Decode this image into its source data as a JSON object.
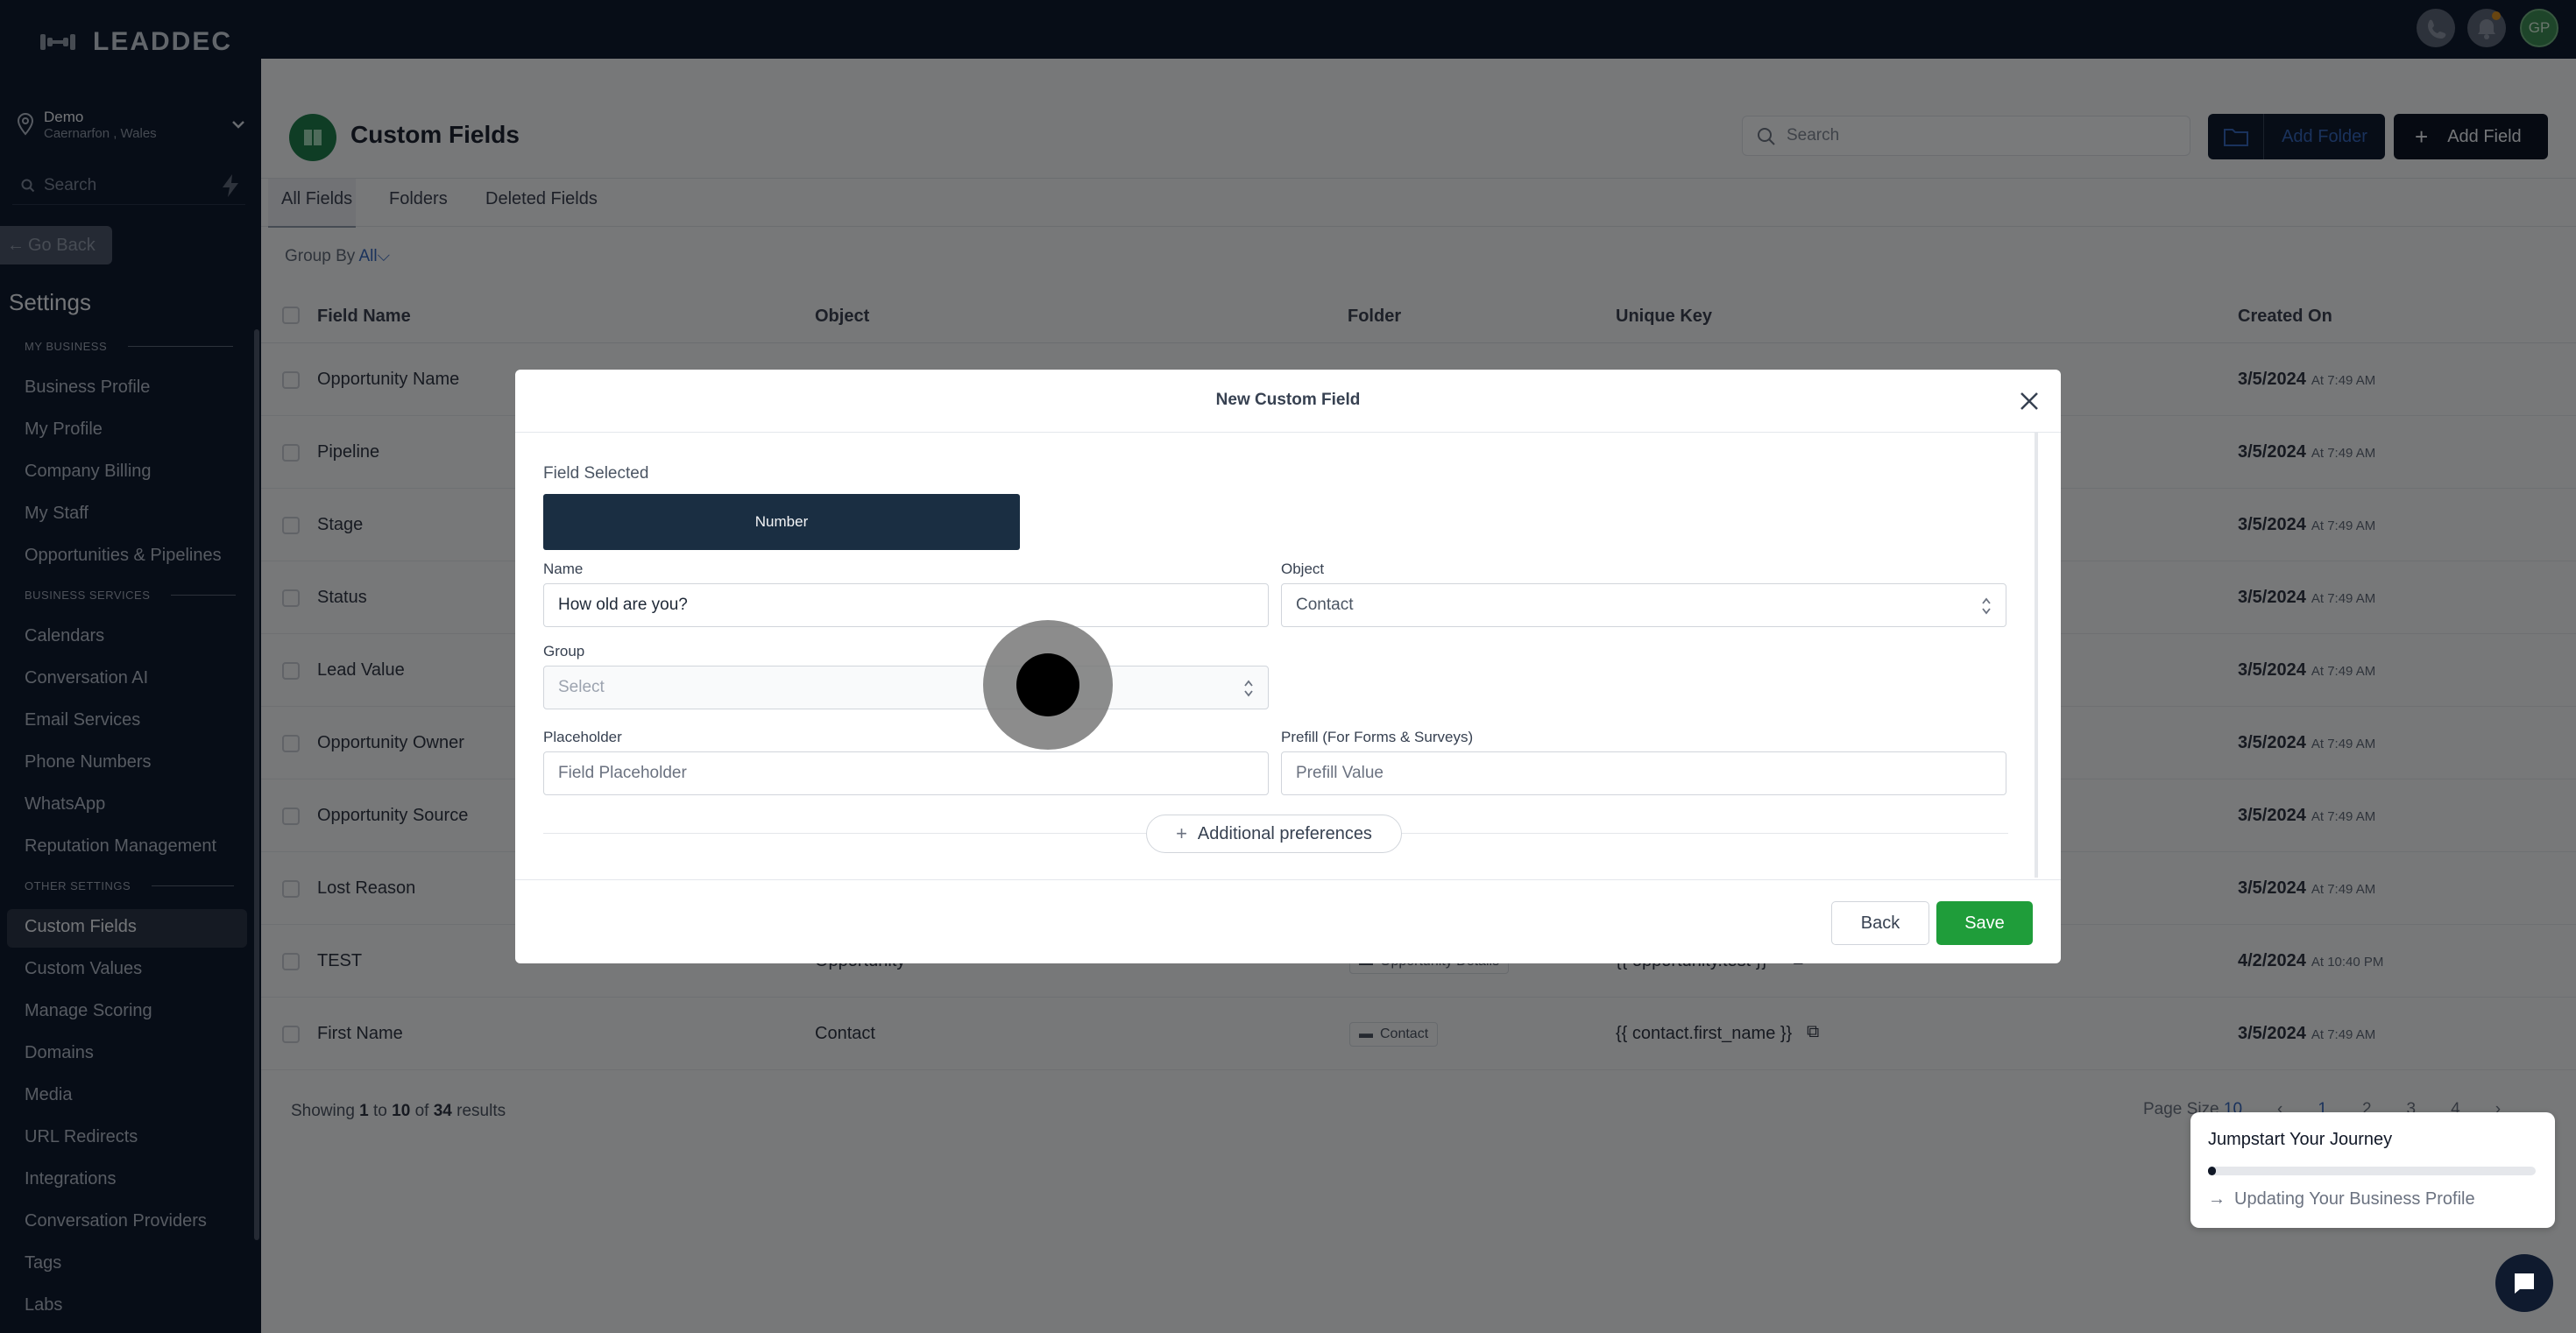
{
  "brand": "LEADDEC",
  "location": {
    "name": "Demo",
    "address": "Caernarfon , Wales"
  },
  "sidebar": {
    "search_placeholder": "Search",
    "go_back": "Go Back",
    "heading": "Settings",
    "sections": {
      "my_business": "MY BUSINESS",
      "business_services": "BUSINESS SERVICES",
      "other_settings": "OTHER SETTINGS"
    },
    "items": [
      "Business Profile",
      "My Profile",
      "Company Billing",
      "My Staff",
      "Opportunities & Pipelines",
      "Calendars",
      "Conversation AI",
      "Email Services",
      "Phone Numbers",
      "WhatsApp",
      "Reputation Management",
      "Custom Fields",
      "Custom Values",
      "Manage Scoring",
      "Domains",
      "Media",
      "URL Redirects",
      "Integrations",
      "Conversation Providers",
      "Tags",
      "Labs"
    ]
  },
  "topbar": {
    "avatar_initials": "GP"
  },
  "page": {
    "title": "Custom Fields",
    "search_placeholder": "Search",
    "add_folder": "Add Folder",
    "add_field": "Add Field",
    "tabs": [
      "All Fields",
      "Folders",
      "Deleted Fields"
    ],
    "group_by_label": "Group By",
    "group_by_value": "All"
  },
  "table": {
    "columns": [
      "Field Name",
      "Object",
      "Folder",
      "Unique Key",
      "Created On"
    ],
    "rows": [
      {
        "name": "Opportunity Name",
        "date": "3/5/2024",
        "time": "At 7:49 AM"
      },
      {
        "name": "Pipeline",
        "date": "3/5/2024",
        "time": "At 7:49 AM"
      },
      {
        "name": "Stage",
        "date": "3/5/2024",
        "time": "At 7:49 AM"
      },
      {
        "name": "Status",
        "date": "3/5/2024",
        "time": "At 7:49 AM"
      },
      {
        "name": "Lead Value",
        "date": "3/5/2024",
        "time": "At 7:49 AM"
      },
      {
        "name": "Opportunity Owner",
        "date": "3/5/2024",
        "time": "At 7:49 AM"
      },
      {
        "name": "Opportunity Source",
        "date": "3/5/2024",
        "time": "At 7:49 AM"
      },
      {
        "name": "Lost Reason",
        "date": "3/5/2024",
        "time": "At 7:49 AM"
      },
      {
        "name": "TEST",
        "object": "Opportunity",
        "folder": "Opportunity Details",
        "key": "{{ opportunity.test }}",
        "date": "4/2/2024",
        "time": "At 10:40 PM"
      },
      {
        "name": "First Name",
        "object": "Contact",
        "folder": "Contact",
        "key": "{{ contact.first_name }}",
        "date": "3/5/2024",
        "time": "At 7:49 AM"
      }
    ],
    "showing": {
      "prefix": "Showing",
      "from": "1",
      "to_word": "to",
      "to": "10",
      "of_word": "of",
      "total": "34",
      "suffix": "results"
    },
    "pager": {
      "page_size_label": "Page Size",
      "page_size": "10",
      "pages": [
        "1",
        "2",
        "3",
        "4"
      ]
    }
  },
  "modal": {
    "title": "New Custom Field",
    "field_selected_label": "Field Selected",
    "field_type": "Number",
    "name_label": "Name",
    "name_value": "How old are you?",
    "object_label": "Object",
    "object_value": "Contact",
    "group_label": "Group",
    "group_placeholder": "Select",
    "placeholder_label": "Placeholder",
    "placeholder_placeholder": "Field Placeholder",
    "prefill_label": "Prefill (For Forms & Surveys)",
    "prefill_placeholder": "Prefill Value",
    "additional_preferences": "Additional preferences",
    "back": "Back",
    "save": "Save"
  },
  "jumpstart": {
    "title": "Jumpstart Your Journey",
    "step": "Updating Your Business Profile",
    "progress": 0.02
  }
}
